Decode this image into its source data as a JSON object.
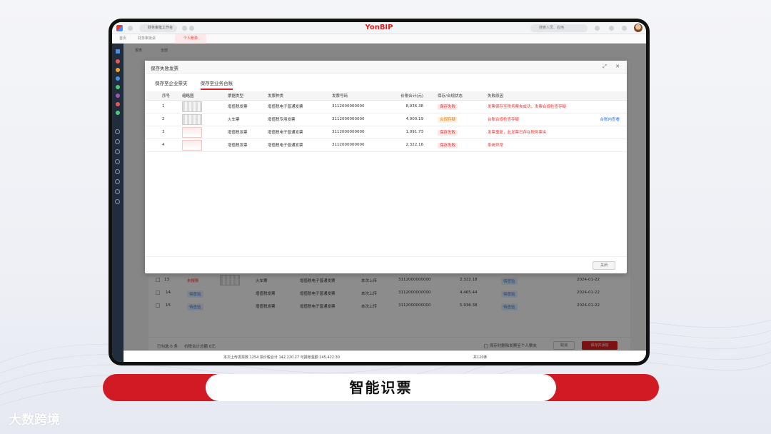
{
  "browser": {
    "workspace": "财务审批工作台",
    "brand": "YonBIP",
    "search_placeholder": "搜索人员、应用",
    "tabs": [
      "首页",
      "财务审批桌",
      "个人账单"
    ]
  },
  "background_app": {
    "header_tabs": [
      "报表",
      "全部"
    ],
    "rows": [
      {
        "no": "13",
        "status": "未报账",
        "type": "火车票",
        "kind": "增值税电子普通发票",
        "source": "本次上传",
        "invoice_no": "3112000000000",
        "amount": "2,322.18",
        "state": "待查验",
        "date": "2024-01-22"
      },
      {
        "no": "14",
        "status": "待查验",
        "type": "增值税发票",
        "kind": "增值税电子普通发票",
        "source": "本次上传",
        "invoice_no": "3112000000000",
        "amount": "4,465.44",
        "state": "待查验",
        "date": "2024-01-22"
      },
      {
        "no": "15",
        "status": "待查验",
        "type": "增值税发票",
        "kind": "增值税电子普通发票",
        "source": "本次上传",
        "invoice_no": "3112000000000",
        "amount": "5,936.38",
        "state": "待查验",
        "date": "2024-01-22"
      }
    ],
    "footer_selected": "已勾选 0 条",
    "footer_total": "价税合计总额 0元",
    "footer_checkbox_label": "保存时删除发票至个人票夹",
    "cancel_label": "取消",
    "save_label": "保存并添加",
    "bottom_stats": "本次上传发票数 1254  票价税合计 142,220.27  可报账金额 245,422.30",
    "pagination": "共120条"
  },
  "dialog": {
    "title": "保存失败发票",
    "subtabs": [
      "保存至企业票夹",
      "保存至业务台账"
    ],
    "columns": [
      "序号",
      "缩略图",
      "票据类型",
      "发票种类",
      "发票号码",
      "价税合计(元)",
      "保存/合规状态",
      "失败原因"
    ],
    "rows": [
      {
        "no": "1",
        "type": "增值税发票",
        "kind": "增值税电子普通发票",
        "invoice_no": "3112000000000",
        "amount": "8,936.38",
        "status": "保存失败",
        "status_kind": "fail",
        "reason": "发票保存至税务票夹成功，发票合规检查存疑",
        "action": ""
      },
      {
        "no": "2",
        "type": "火车票",
        "kind": "增值税专用发票",
        "invoice_no": "3112000000000",
        "amount": "4,900.19",
        "status": "合规存疑",
        "status_kind": "warn",
        "reason": "台账合规检查存疑",
        "action": "台账内查看"
      },
      {
        "no": "3",
        "type": "增值税发票",
        "kind": "增值税电子普通发票",
        "invoice_no": "3112000000000",
        "amount": "1,091.73",
        "status": "保存失败",
        "status_kind": "fail",
        "reason": "发票重复，此发票已存在税务票夹",
        "action": ""
      },
      {
        "no": "4",
        "type": "增值税发票",
        "kind": "增值税电子普通发票",
        "invoice_no": "3112000000000",
        "amount": "2,322.16",
        "status": "保存失败",
        "status_kind": "fail",
        "reason": "系统异常",
        "action": ""
      }
    ],
    "close_label": "关闭"
  },
  "caption": "智能识票",
  "watermark": "大数跨境",
  "colors": {
    "brand_red": "#d11a24",
    "fail_red": "#e33333",
    "warn_orange": "#e07b12",
    "link_blue": "#2c6fd6"
  }
}
